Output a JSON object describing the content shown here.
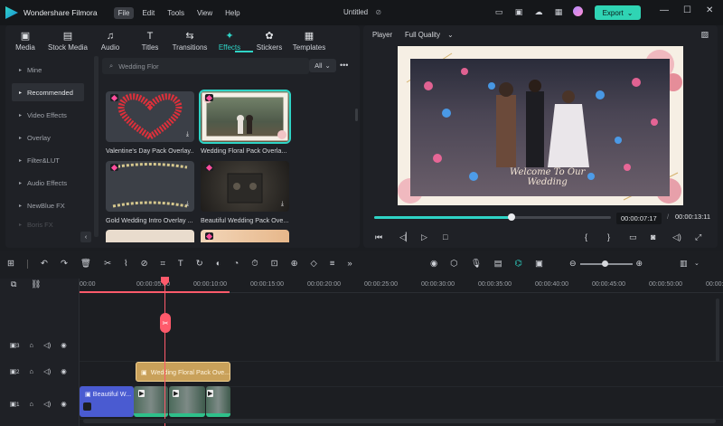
{
  "titlebar": {
    "app_name": "Wondershare Filmora",
    "menu": [
      "File",
      "Edit",
      "Tools",
      "View",
      "Help"
    ],
    "document": "Untitled",
    "export_label": "Export"
  },
  "library": {
    "categories": [
      {
        "label": "Media",
        "icon": "▣"
      },
      {
        "label": "Stock Media",
        "icon": "▤"
      },
      {
        "label": "Audio",
        "icon": "♫"
      },
      {
        "label": "Titles",
        "icon": "T"
      },
      {
        "label": "Transitions",
        "icon": "⇆"
      },
      {
        "label": "Effects",
        "icon": "✦"
      },
      {
        "label": "Stickers",
        "icon": "✿"
      },
      {
        "label": "Templates",
        "icon": "▦"
      }
    ],
    "sidebar": [
      "Mine",
      "Recommended",
      "Video Effects",
      "Overlay",
      "Filter&LUT",
      "Audio Effects",
      "NewBlue FX",
      "Boris FX"
    ],
    "search_placeholder": "Wedding Flor",
    "filter": "All",
    "cards": [
      {
        "caption": "Valentine's Day Pack Overlay..."
      },
      {
        "caption": "Wedding Floral Pack Overla..."
      },
      {
        "caption": "Gold Wedding Intro Overlay ..."
      },
      {
        "caption": "Beautiful Wedding Pack Ove..."
      }
    ]
  },
  "player": {
    "label": "Player",
    "quality": "Full Quality",
    "overlay_text_line1": "Welcome To Our",
    "overlay_text_line2": "Wedding",
    "current_time": "00:00:07:17",
    "separator": "/",
    "total_time": "00:00:13:11",
    "progress_percent": 58
  },
  "timeline": {
    "ruler": [
      "00:00",
      "00:00:05:00",
      "00:00:10:00",
      "00:00:15:00",
      "00:00:20:00",
      "00:00:25:00",
      "00:00:30:00",
      "00:00:35:00",
      "00:00:40:00",
      "00:00:45:00",
      "00:00:50:00",
      "00:00:55:00"
    ],
    "tracks": [
      "3",
      "2",
      "1"
    ],
    "effect_clip": "Wedding Floral Pack Ove...",
    "title_clip": "Beautiful W..."
  },
  "colors": {
    "accent": "#2fd4c6",
    "playhead": "#ff5a6b",
    "effect_clip": "#c9a15a",
    "title_clip": "#4a5bd1"
  }
}
